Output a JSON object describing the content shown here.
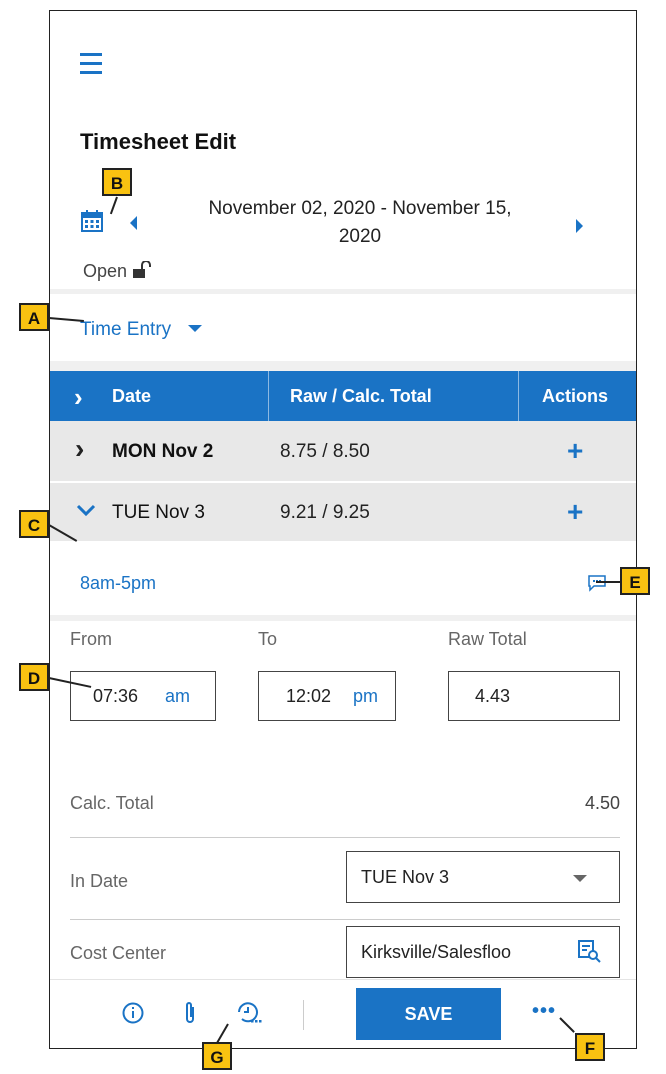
{
  "header": {
    "title": "Timesheet Edit"
  },
  "period": {
    "range_line1": "November 02, 2020 - November 15,",
    "range_line2": "2020",
    "status": "Open"
  },
  "view_selector": {
    "label": "Time Entry"
  },
  "table": {
    "columns": [
      "Date",
      "Raw / Calc. Total",
      "Actions"
    ],
    "rows": [
      {
        "date": "MON Nov 2",
        "totals": "8.75 / 8.50",
        "action": "+"
      },
      {
        "date": "TUE Nov 3",
        "totals": "9.21 / 9.25",
        "action": "+"
      }
    ]
  },
  "shift": {
    "label": "8am-5pm"
  },
  "entry": {
    "from_label": "From",
    "to_label": "To",
    "raw_total_label": "Raw Total",
    "from_time": "07:36",
    "from_ampm": "am",
    "to_time": "12:02",
    "to_ampm": "pm",
    "raw_total": "4.43",
    "calc_total_label": "Calc. Total",
    "calc_total": "4.50",
    "in_date_label": "In Date",
    "in_date": "TUE Nov 3",
    "cost_center_label": "Cost Center",
    "cost_center": "Kirksville/Salesfloo"
  },
  "footer": {
    "save_label": "SAVE",
    "more_label": "•••"
  },
  "callouts": {
    "a": "A",
    "b": "B",
    "c": "C",
    "d": "D",
    "e": "E",
    "f": "F",
    "g": "G"
  },
  "colors": {
    "accent": "#1a73c5",
    "callout": "#f9c211"
  }
}
